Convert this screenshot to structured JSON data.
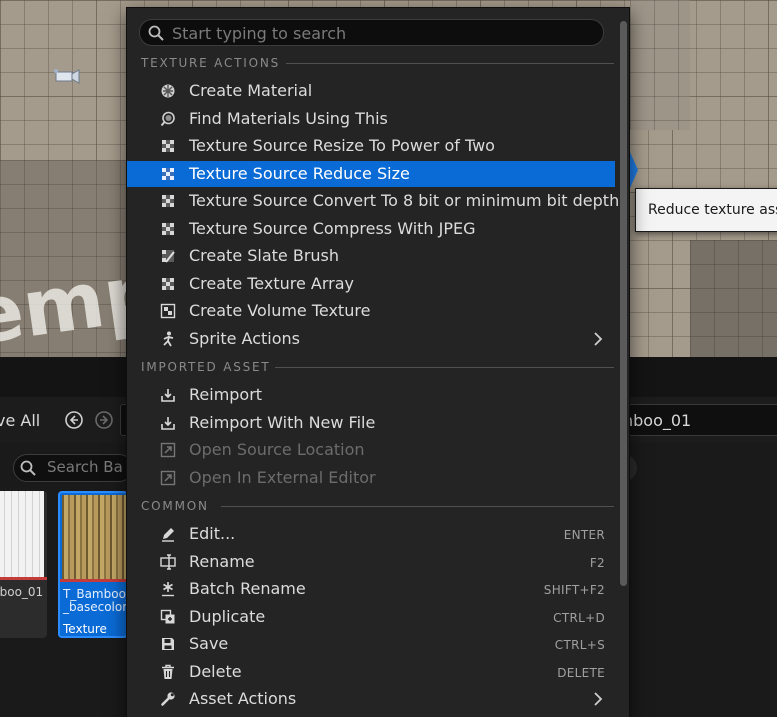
{
  "menu": {
    "search_placeholder": "Start typing to search",
    "sections": {
      "texture_actions": "TEXTURE ACTIONS",
      "imported_asset": "IMPORTED ASSET",
      "common": "COMMON"
    },
    "items": [
      {
        "id": "create-material",
        "icon": "material-sphere-icon",
        "label": "Create Material"
      },
      {
        "id": "find-materials",
        "icon": "find-material-icon",
        "label": "Find Materials Using This"
      },
      {
        "id": "resize-power-of-two",
        "icon": "texture-checker-icon",
        "label": "Texture Source Resize To Power of Two"
      },
      {
        "id": "reduce-size",
        "icon": "texture-checker-icon",
        "label": "Texture Source Reduce Size",
        "selected": true
      },
      {
        "id": "convert-8-bit",
        "icon": "texture-checker-icon",
        "label": "Texture Source Convert To 8 bit or minimum bit depth"
      },
      {
        "id": "compress-jpeg",
        "icon": "texture-checker-icon",
        "label": "Texture Source Compress With JPEG"
      },
      {
        "id": "create-slate-brush",
        "icon": "slate-brush-icon",
        "label": "Create Slate Brush"
      },
      {
        "id": "create-texture-array",
        "icon": "texture-checker-icon",
        "label": "Create Texture Array"
      },
      {
        "id": "create-volume-texture",
        "icon": "volume-texture-icon",
        "label": "Create Volume Texture"
      },
      {
        "id": "sprite-actions",
        "icon": "sprite-icon",
        "label": "Sprite Actions",
        "submenu": true
      },
      {
        "id": "reimport",
        "icon": "reimport-icon",
        "label": "Reimport"
      },
      {
        "id": "reimport-new-file",
        "icon": "reimport-icon",
        "label": "Reimport With New File"
      },
      {
        "id": "open-source-location",
        "icon": "open-location-icon",
        "label": "Open Source Location",
        "disabled": true
      },
      {
        "id": "open-external-editor",
        "icon": "external-editor-icon",
        "label": "Open In External Editor",
        "disabled": true
      },
      {
        "id": "edit",
        "icon": "pencil-icon",
        "label": "Edit...",
        "shortcut": "ENTER"
      },
      {
        "id": "rename",
        "icon": "rename-icon",
        "label": "Rename",
        "shortcut": "F2"
      },
      {
        "id": "batch-rename",
        "icon": "batch-rename-icon",
        "label": "Batch Rename",
        "shortcut": "SHIFT+F2"
      },
      {
        "id": "duplicate",
        "icon": "duplicate-icon",
        "label": "Duplicate",
        "shortcut": "CTRL+D"
      },
      {
        "id": "save",
        "icon": "save-icon",
        "label": "Save",
        "shortcut": "CTRL+S"
      },
      {
        "id": "delete",
        "icon": "trash-icon",
        "label": "Delete",
        "shortcut": "DELETE"
      },
      {
        "id": "asset-actions",
        "icon": "wrench-icon",
        "label": "Asset Actions",
        "submenu": true
      }
    ]
  },
  "tooltip": {
    "text": "Reduce texture ass"
  },
  "viewport": {
    "overlay_text": "empl"
  },
  "content_browser": {
    "save_all_label": "ve All",
    "path_text": "nboo_01",
    "search_placeholder": "Search Ba",
    "assets": [
      {
        "name": "nboo_01",
        "type": ""
      },
      {
        "name": "T_Bamboo_\n_basecolor",
        "type": "Texture",
        "selected": true
      }
    ]
  },
  "colors": {
    "menu_bg": "#242424",
    "selection": "#0a6bd6",
    "text": "#dcdcdc",
    "disabled_text": "#6c6c6c",
    "section_text": "#8a8a8a"
  }
}
